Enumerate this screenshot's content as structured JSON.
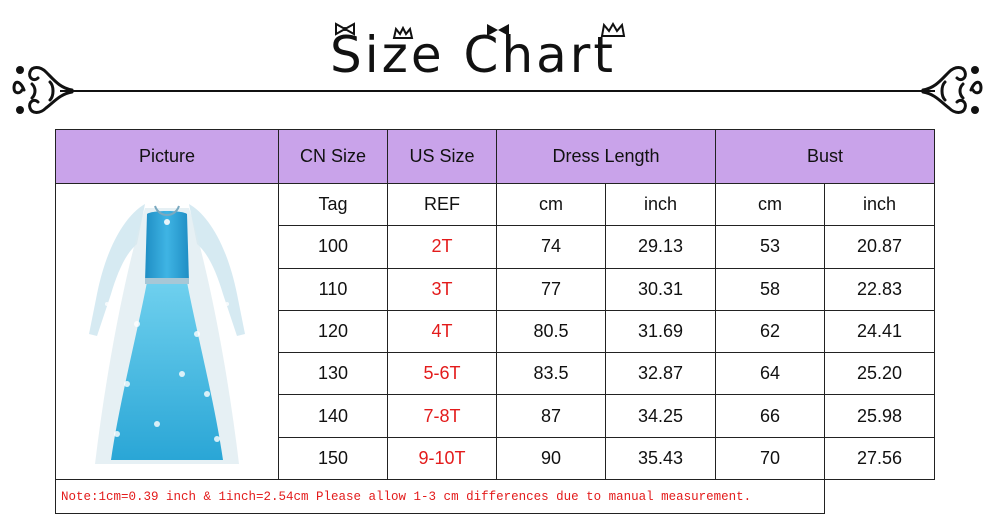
{
  "title": "Size Chart",
  "headers": {
    "picture": "Picture",
    "cn_size": "CN Size",
    "us_size": "US Size",
    "dress_length": "Dress Length",
    "bust": "Bust"
  },
  "subheaders": {
    "cn": "Tag",
    "us": "REF",
    "dress_cm": "cm",
    "dress_inch": "inch",
    "bust_cm": "cm",
    "bust_inch": "inch"
  },
  "rows": [
    {
      "cn": "100",
      "us": "2T",
      "dress_cm": "74",
      "dress_inch": "29.13",
      "bust_cm": "53",
      "bust_inch": "20.87"
    },
    {
      "cn": "110",
      "us": "3T",
      "dress_cm": "77",
      "dress_inch": "30.31",
      "bust_cm": "58",
      "bust_inch": "22.83"
    },
    {
      "cn": "120",
      "us": "4T",
      "dress_cm": "80.5",
      "dress_inch": "31.69",
      "bust_cm": "62",
      "bust_inch": "24.41"
    },
    {
      "cn": "130",
      "us": "5-6T",
      "dress_cm": "83.5",
      "dress_inch": "32.87",
      "bust_cm": "64",
      "bust_inch": "25.20"
    },
    {
      "cn": "140",
      "us": "7-8T",
      "dress_cm": "87",
      "dress_inch": "34.25",
      "bust_cm": "66",
      "bust_inch": "25.98"
    },
    {
      "cn": "150",
      "us": "9-10T",
      "dress_cm": "90",
      "dress_inch": "35.43",
      "bust_cm": "70",
      "bust_inch": "27.56"
    }
  ],
  "note": "Note:1cm=0.39 inch & 1inch=2.54cm Please allow 1-3 cm differences due to manual measurement.",
  "colors": {
    "header_bg": "#c9a3ea",
    "us_size_text": "#e31b1b",
    "note_text": "#e31b1b"
  }
}
